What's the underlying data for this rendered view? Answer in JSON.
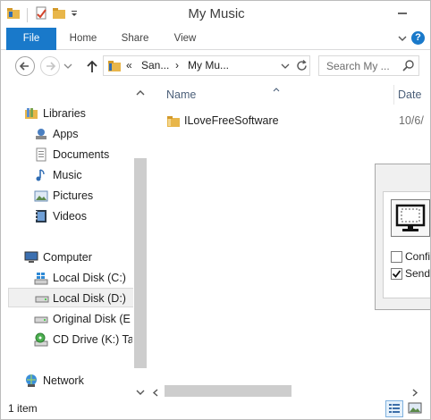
{
  "window": {
    "title": "My Music"
  },
  "quick_access": {
    "icons": [
      "folder-properties-icon",
      "checkmark-document-icon",
      "new-folder-icon",
      "customize-dropdown-icon"
    ]
  },
  "ribbon": {
    "tabs": [
      {
        "label": "File",
        "active": true
      },
      {
        "label": "Home"
      },
      {
        "label": "Share"
      },
      {
        "label": "View"
      }
    ],
    "help_label": "?"
  },
  "address_bar": {
    "overflow": "«",
    "crumbs": [
      "San...",
      "My Mu..."
    ],
    "separator": "›"
  },
  "search": {
    "placeholder": "Search My ..."
  },
  "nav_pane": {
    "libraries": {
      "label": "Libraries",
      "items": [
        "Apps",
        "Documents",
        "Music",
        "Pictures",
        "Videos"
      ]
    },
    "computer": {
      "label": "Computer",
      "items": [
        "Local Disk (C:)",
        "Local Disk (D:)",
        "Original Disk (E",
        "CD Drive (K:) Ta"
      ],
      "selected": "Local Disk (D:)"
    },
    "network": {
      "label": "Network"
    }
  },
  "file_list": {
    "columns": [
      "Name",
      "Date"
    ],
    "rows": [
      {
        "name": "ILoveFreeSoftware",
        "date": "10/6/"
      }
    ]
  },
  "dialog": {
    "options": [
      {
        "label": "Confir",
        "checked": false
      },
      {
        "label": "Send t",
        "checked": true
      }
    ]
  },
  "status_bar": {
    "text": "1 item",
    "views": [
      "details-view",
      "large-icons-view"
    ]
  },
  "colors": {
    "accent": "#1979ca",
    "folder": "#e8b64a",
    "scroll_thumb": "#cdcdcd"
  }
}
